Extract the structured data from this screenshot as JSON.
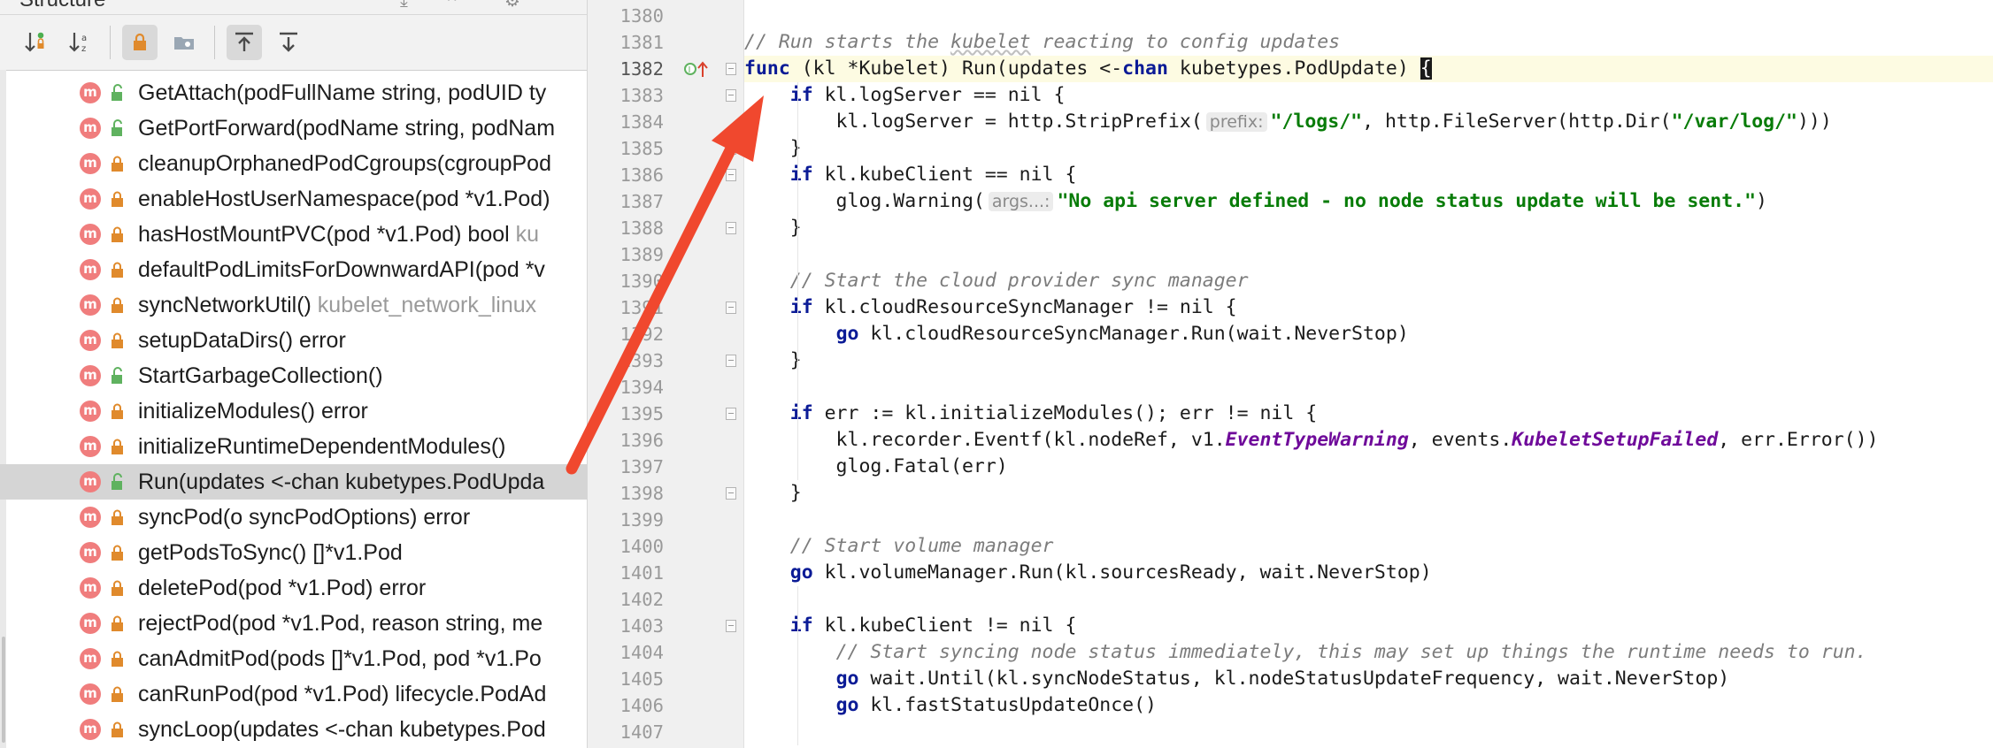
{
  "structure_panel": {
    "title": "Structure",
    "items": [
      {
        "name": "GetAttach(podFullName string, podUID ty",
        "hint": "",
        "visibility": "public"
      },
      {
        "name": "GetPortForward(podName string, podNam",
        "hint": "",
        "visibility": "public"
      },
      {
        "name": "cleanupOrphanedPodCgroups(cgroupPod",
        "hint": "",
        "visibility": "private"
      },
      {
        "name": "enableHostUserNamespace(pod *v1.Pod)",
        "hint": "",
        "visibility": "private"
      },
      {
        "name": "hasHostMountPVC(pod *v1.Pod) bool ",
        "hint": "ku",
        "visibility": "private"
      },
      {
        "name": "defaultPodLimitsForDownwardAPI(pod *v",
        "hint": "",
        "visibility": "private"
      },
      {
        "name": "syncNetworkUtil() ",
        "hint": "kubelet_network_linux",
        "visibility": "private"
      },
      {
        "name": "setupDataDirs() error",
        "hint": "",
        "visibility": "private"
      },
      {
        "name": "StartGarbageCollection()",
        "hint": "",
        "visibility": "public"
      },
      {
        "name": "initializeModules() error",
        "hint": "",
        "visibility": "private"
      },
      {
        "name": "initializeRuntimeDependentModules()",
        "hint": "",
        "visibility": "private"
      },
      {
        "name": "Run(updates <-chan kubetypes.PodUpda",
        "hint": "",
        "visibility": "public",
        "selected": true
      },
      {
        "name": "syncPod(o syncPodOptions) error",
        "hint": "",
        "visibility": "private"
      },
      {
        "name": "getPodsToSync() []*v1.Pod",
        "hint": "",
        "visibility": "private"
      },
      {
        "name": "deletePod(pod *v1.Pod) error",
        "hint": "",
        "visibility": "private"
      },
      {
        "name": "rejectPod(pod *v1.Pod, reason string, me",
        "hint": "",
        "visibility": "private"
      },
      {
        "name": "canAdmitPod(pods []*v1.Pod, pod *v1.Po",
        "hint": "",
        "visibility": "private"
      },
      {
        "name": "canRunPod(pod *v1.Pod) lifecycle.PodAd",
        "hint": "",
        "visibility": "private"
      },
      {
        "name": "syncLoop(updates <-chan kubetypes.Pod",
        "hint": "",
        "visibility": "private"
      }
    ]
  },
  "editor": {
    "current_line": "1382",
    "lines": [
      {
        "n": "1380",
        "tokens": []
      },
      {
        "n": "1381",
        "tokens": [
          [
            "cm",
            "// Run starts the "
          ],
          [
            "cm ul",
            "kubelet"
          ],
          [
            "cm",
            " reacting to config updates"
          ]
        ]
      },
      {
        "n": "1382",
        "tokens": [
          [
            "kw",
            "func"
          ],
          [
            "",
            " (kl *Kubelet) Run(updates <-"
          ],
          [
            "kw",
            "chan"
          ],
          [
            "",
            " kubetypes.PodUpdate) "
          ],
          [
            "bracehl",
            "{"
          ]
        ]
      },
      {
        "n": "1383",
        "tokens": [
          [
            "",
            "    "
          ],
          [
            "kw",
            "if"
          ],
          [
            "",
            " kl.logServer == nil {"
          ]
        ]
      },
      {
        "n": "1384",
        "tokens": [
          [
            "",
            "        kl.logServer = http.StripPrefix("
          ],
          [
            "hintbox",
            "prefix:"
          ],
          [
            "str",
            "\"/logs/\""
          ],
          [
            "",
            ", http.FileServer(http.Dir("
          ],
          [
            "str",
            "\"/var/log/\""
          ],
          [
            "",
            ")))"
          ]
        ]
      },
      {
        "n": "1385",
        "tokens": [
          [
            "",
            "    }"
          ]
        ]
      },
      {
        "n": "1386",
        "tokens": [
          [
            "",
            "    "
          ],
          [
            "kw",
            "if"
          ],
          [
            "",
            " kl.kubeClient == nil {"
          ]
        ]
      },
      {
        "n": "1387",
        "tokens": [
          [
            "",
            "        glog.Warning("
          ],
          [
            "hintbox",
            "args...:"
          ],
          [
            "str",
            "\"No api server defined - no node status update will be sent.\""
          ],
          [
            "",
            ")"
          ]
        ]
      },
      {
        "n": "1388",
        "tokens": [
          [
            "",
            "    }"
          ]
        ]
      },
      {
        "n": "1389",
        "tokens": []
      },
      {
        "n": "1390",
        "tokens": [
          [
            "",
            "    "
          ],
          [
            "cm",
            "// Start the cloud provider sync manager"
          ]
        ]
      },
      {
        "n": "1391",
        "tokens": [
          [
            "",
            "    "
          ],
          [
            "kw",
            "if"
          ],
          [
            "",
            " kl.cloudResourceSyncManager != nil {"
          ]
        ]
      },
      {
        "n": "1392",
        "tokens": [
          [
            "",
            "        "
          ],
          [
            "kw",
            "go"
          ],
          [
            "",
            " kl.cloudResourceSyncManager.Run(wait.NeverStop)"
          ]
        ]
      },
      {
        "n": "1393",
        "tokens": [
          [
            "",
            "    }"
          ]
        ]
      },
      {
        "n": "1394",
        "tokens": []
      },
      {
        "n": "1395",
        "tokens": [
          [
            "",
            "    "
          ],
          [
            "kw",
            "if"
          ],
          [
            "",
            " err := kl.initializeModules(); err != nil {"
          ]
        ]
      },
      {
        "n": "1396",
        "tokens": [
          [
            "",
            "        kl.recorder.Eventf(kl.nodeRef, v1."
          ],
          [
            "const",
            "EventTypeWarning"
          ],
          [
            "",
            ", events."
          ],
          [
            "const",
            "KubeletSetupFailed"
          ],
          [
            "",
            ", err.Error())"
          ]
        ]
      },
      {
        "n": "1397",
        "tokens": [
          [
            "",
            "        glog.Fatal(err)"
          ]
        ]
      },
      {
        "n": "1398",
        "tokens": [
          [
            "",
            "    }"
          ]
        ]
      },
      {
        "n": "1399",
        "tokens": []
      },
      {
        "n": "1400",
        "tokens": [
          [
            "",
            "    "
          ],
          [
            "cm",
            "// Start volume manager"
          ]
        ]
      },
      {
        "n": "1401",
        "tokens": [
          [
            "",
            "    "
          ],
          [
            "kw",
            "go"
          ],
          [
            "",
            " kl.volumeManager.Run(kl.sourcesReady, wait.NeverStop)"
          ]
        ]
      },
      {
        "n": "1402",
        "tokens": []
      },
      {
        "n": "1403",
        "tokens": [
          [
            "",
            "    "
          ],
          [
            "kw",
            "if"
          ],
          [
            "",
            " kl.kubeClient != nil {"
          ]
        ]
      },
      {
        "n": "1404",
        "tokens": [
          [
            "",
            "        "
          ],
          [
            "cm",
            "// Start syncing node status immediately, this may set up things the runtime needs to run."
          ]
        ]
      },
      {
        "n": "1405",
        "tokens": [
          [
            "",
            "        "
          ],
          [
            "kw",
            "go"
          ],
          [
            "",
            " wait.Until(kl.syncNodeStatus, kl.nodeStatusUpdateFrequency, wait.NeverStop)"
          ]
        ]
      },
      {
        "n": "1406",
        "tokens": [
          [
            "",
            "        "
          ],
          [
            "kw",
            "go"
          ],
          [
            "",
            " kl.fastStatusUpdateOnce()"
          ]
        ]
      },
      {
        "n": "1407",
        "tokens": []
      }
    ]
  },
  "colors": {
    "annotation_arrow": "#f0482e",
    "keyword": "#0b1b96",
    "string": "#087c08",
    "comment": "#7c7c7c",
    "constant": "#6f0a9a",
    "method_badge": "#f07d7d"
  },
  "icons": {
    "toolbar": [
      "sort-by-visibility-icon",
      "sort-alpha-icon",
      "show-private-lock-icon",
      "show-fields-folder-icon",
      "autoscroll-to-source-icon",
      "autoscroll-from-source-icon"
    ],
    "method_badge_letter": "m"
  }
}
